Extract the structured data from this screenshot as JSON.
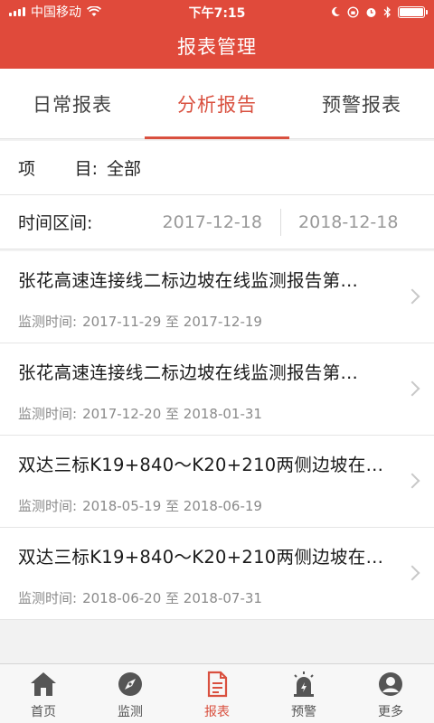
{
  "status_bar": {
    "carrier": "中国移动",
    "time": "下午7:15"
  },
  "header": {
    "title": "报表管理"
  },
  "tabs": [
    {
      "label": "日常报表",
      "active": false
    },
    {
      "label": "分析报告",
      "active": true
    },
    {
      "label": "预警报表",
      "active": false
    }
  ],
  "filters": {
    "project_label_a": "项",
    "project_label_b": "目:",
    "project_value": "全部",
    "time_label": "时间区间:",
    "start_date": "2017-12-18",
    "end_date": "2018-12-18"
  },
  "reports": [
    {
      "title": "张花高速连接线二标边坡在线监测报告第…",
      "time_label": "监测时间:",
      "range": "2017-11-29 至 2017-12-19"
    },
    {
      "title": "张花高速连接线二标边坡在线监测报告第…",
      "time_label": "监测时间:",
      "range": "2017-12-20 至 2018-01-31"
    },
    {
      "title": "双达三标K19+840～K20+210两侧边坡在…",
      "time_label": "监测时间:",
      "range": "2018-05-19 至 2018-06-19"
    },
    {
      "title": "双达三标K19+840～K20+210两侧边坡在…",
      "time_label": "监测时间:",
      "range": "2018-06-20 至 2018-07-31"
    }
  ],
  "bottom_nav": [
    {
      "label": "首页",
      "icon": "home-icon",
      "active": false
    },
    {
      "label": "监测",
      "icon": "compass-icon",
      "active": false
    },
    {
      "label": "报表",
      "icon": "report-icon",
      "active": true
    },
    {
      "label": "预警",
      "icon": "alarm-icon",
      "active": false
    },
    {
      "label": "更多",
      "icon": "user-icon",
      "active": false
    }
  ],
  "colors": {
    "brand": "#e04a3b",
    "accent": "#d9503f"
  }
}
